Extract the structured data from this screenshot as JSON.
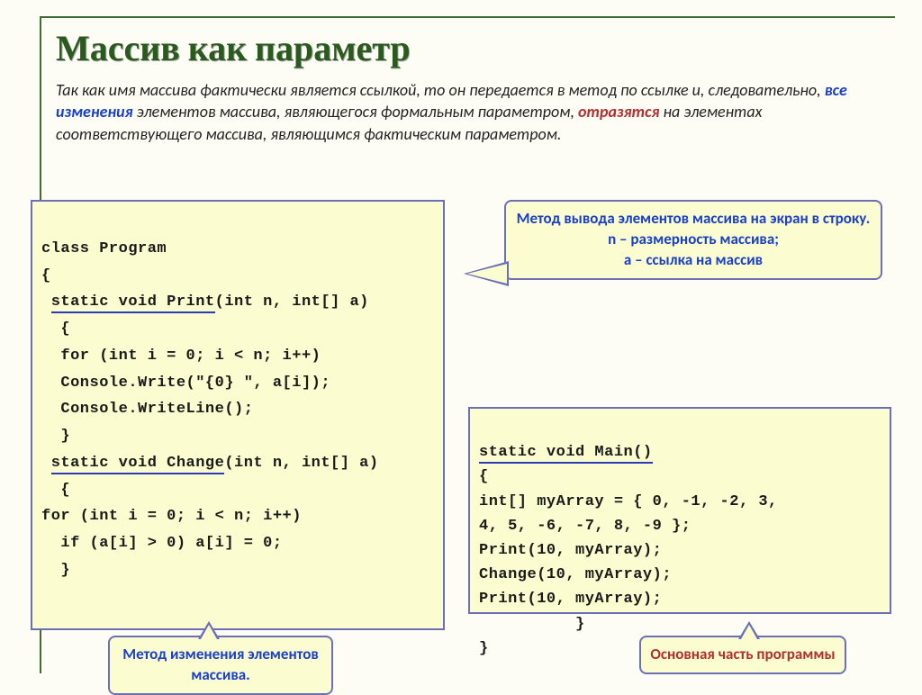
{
  "title": "Массив как параметр",
  "intro_plain_start": "Так как имя массива фактически является ссылкой, то он передается в метод по ссылке и, следовательно, ",
  "intro_hl1": "все изменения",
  "intro_mid1": " элементов массива, являющегося формальным параметром, ",
  "intro_hl2": "отразятся",
  "intro_end": " на элементах соответствующего массива, являющимся фактическим параметром.",
  "code_left": {
    "l1": "class Program",
    "l2": "{",
    "l3_pre": " ",
    "l3_u": "static void Print",
    "l3_post": "(int n, int[] a)",
    "l4": "  {",
    "l5": "  for (int i = 0; i < n; i++)",
    "l6": "  Console.Write(\"{0} \", a[i]);",
    "l7": "  Console.WriteLine();",
    "l8": "  }",
    "l9_pre": " ",
    "l9_u": "static void Change",
    "l9_post": "(int n, int[] a)",
    "l10": "  {",
    "l11": "for (int i = 0; i < n; i++)",
    "l12": "  if (a[i] > 0) a[i] = 0;",
    "l13": "  }"
  },
  "code_right": {
    "r1_u": "static void Main()",
    "r2": "{",
    "r3": "int[] myArray = { 0, -1, -2, 3,",
    "r4": "4, 5, -6, -7, 8, -9 };",
    "r5": "Print(10, myArray);",
    "r6": "Change(10, myArray);",
    "r7": "Print(10, myArray);",
    "r8": "          }",
    "r9": "}"
  },
  "callouts": {
    "top": "Метод вывода элементов массива  на экран в строку.\nn – размерность массива;\na – ссылка на массив",
    "bottom_left": "Метод изменения элементов массива.",
    "bottom_right": "Основная часть программы"
  }
}
